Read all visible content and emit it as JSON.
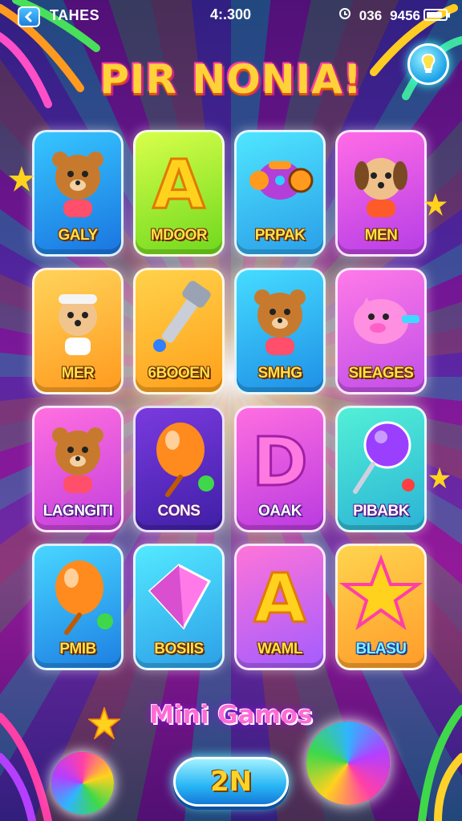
{
  "status_bar": {
    "title": "TAHES",
    "time": "4:.300",
    "right_a": "036",
    "right_b": "9456",
    "battery_level": 0.85
  },
  "game_title": "PIR NONIA!",
  "tiles": [
    {
      "label": "GALY",
      "color_from": "#36c6ff",
      "color_to": "#1a74e0",
      "art": "bear-icon"
    },
    {
      "label": "MDOOR",
      "color_from": "#d8ff4a",
      "color_to": "#6fd81e",
      "art": "letter-a-icon"
    },
    {
      "label": "PRPAK",
      "color_from": "#4fe6ff",
      "color_to": "#2a9ee8",
      "art": "robot-icon"
    },
    {
      "label": "MEN",
      "color_from": "#ff6be6",
      "color_to": "#b63ee6",
      "art": "dog-icon"
    },
    {
      "label": "MER",
      "color_from": "#ffd35a",
      "color_to": "#ff9a1e",
      "art": "pup-icon"
    },
    {
      "label": "6BOOEN",
      "color_from": "#ffd24a",
      "color_to": "#ff9f1a",
      "art": "hammer-icon"
    },
    {
      "label": "SMHG",
      "color_from": "#45dcff",
      "color_to": "#1f8fe6",
      "art": "bear-icon"
    },
    {
      "label": "SIEAGES",
      "color_from": "#ff7ae8",
      "color_to": "#c04ee8",
      "art": "pig-icon"
    },
    {
      "label": "LAGNGITI",
      "color_from": "#ff6fe0",
      "color_to": "#c33fdc",
      "art": "bear-icon"
    },
    {
      "label": "CONS",
      "color_from": "#7a3adf",
      "color_to": "#3f1fa6",
      "art": "balloon-icon"
    },
    {
      "label": "OAAK",
      "color_from": "#ff6ee0",
      "color_to": "#b93ae0",
      "art": "letter-d-icon"
    },
    {
      "label": "PIBABK",
      "color_from": "#52f0d6",
      "color_to": "#2bb3d6",
      "art": "bubble-wand-icon"
    },
    {
      "label": "PMIB",
      "color_from": "#48d6ff",
      "color_to": "#1d7fe3",
      "art": "balloon-icon"
    },
    {
      "label": "BOSIIS",
      "color_from": "#53e9ff",
      "color_to": "#2d9fe8",
      "art": "gem-icon"
    },
    {
      "label": "WAML",
      "color_from": "#ff74d9",
      "color_to": "#a35cff",
      "art": "letter-a-icon"
    },
    {
      "label": "BLASU",
      "color_from": "#ffd44e",
      "color_to": "#ff9b2a",
      "art": "star-icon"
    }
  ],
  "subtitle": "Mini Gamos",
  "play_button": "2N"
}
